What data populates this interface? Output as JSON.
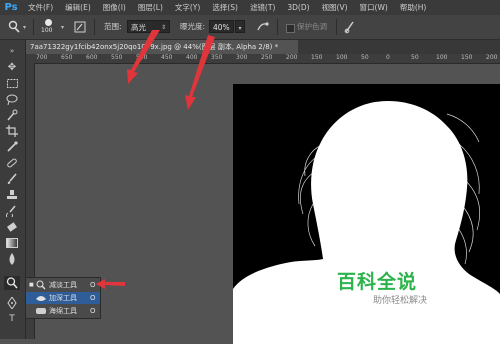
{
  "app": {
    "logo": "Ps"
  },
  "menu": [
    "文件(F)",
    "编辑(E)",
    "图像(I)",
    "图层(L)",
    "文字(Y)",
    "选择(S)",
    "滤镜(T)",
    "3D(D)",
    "视图(V)",
    "窗口(W)",
    "帮助(H)"
  ],
  "options": {
    "brush_size": "100",
    "range_label": "范围:",
    "range_value": "高光",
    "exposure_label": "曝光度:",
    "exposure_value": "40%",
    "protect_tones": "保护色调"
  },
  "document": {
    "tab_title": "7aa71322gy1fcib42onx5j20qo1079x.jpg @ 44%(图层 副本, Alpha 2/8) *"
  },
  "ruler_ticks": [
    "700",
    "650",
    "600",
    "550",
    "500",
    "450",
    "400",
    "350",
    "300",
    "250",
    "200",
    "150",
    "100",
    "50",
    "0",
    "50",
    "100",
    "150",
    "200"
  ],
  "tool_flyout": {
    "items": [
      {
        "label": "减淡工具",
        "shortcut": "O",
        "selected": false,
        "icon": "dodge-icon"
      },
      {
        "label": "加深工具",
        "shortcut": "O",
        "selected": true,
        "icon": "burn-icon"
      },
      {
        "label": "海绵工具",
        "shortcut": "O",
        "selected": false,
        "icon": "sponge-icon"
      }
    ]
  },
  "watermark": {
    "title": "百科全说",
    "subtitle": "助你轻松解决"
  },
  "colors": {
    "annotation_arrow": "#e0353a",
    "accent": "#3fa9f5",
    "watermark": "#2db34b"
  }
}
